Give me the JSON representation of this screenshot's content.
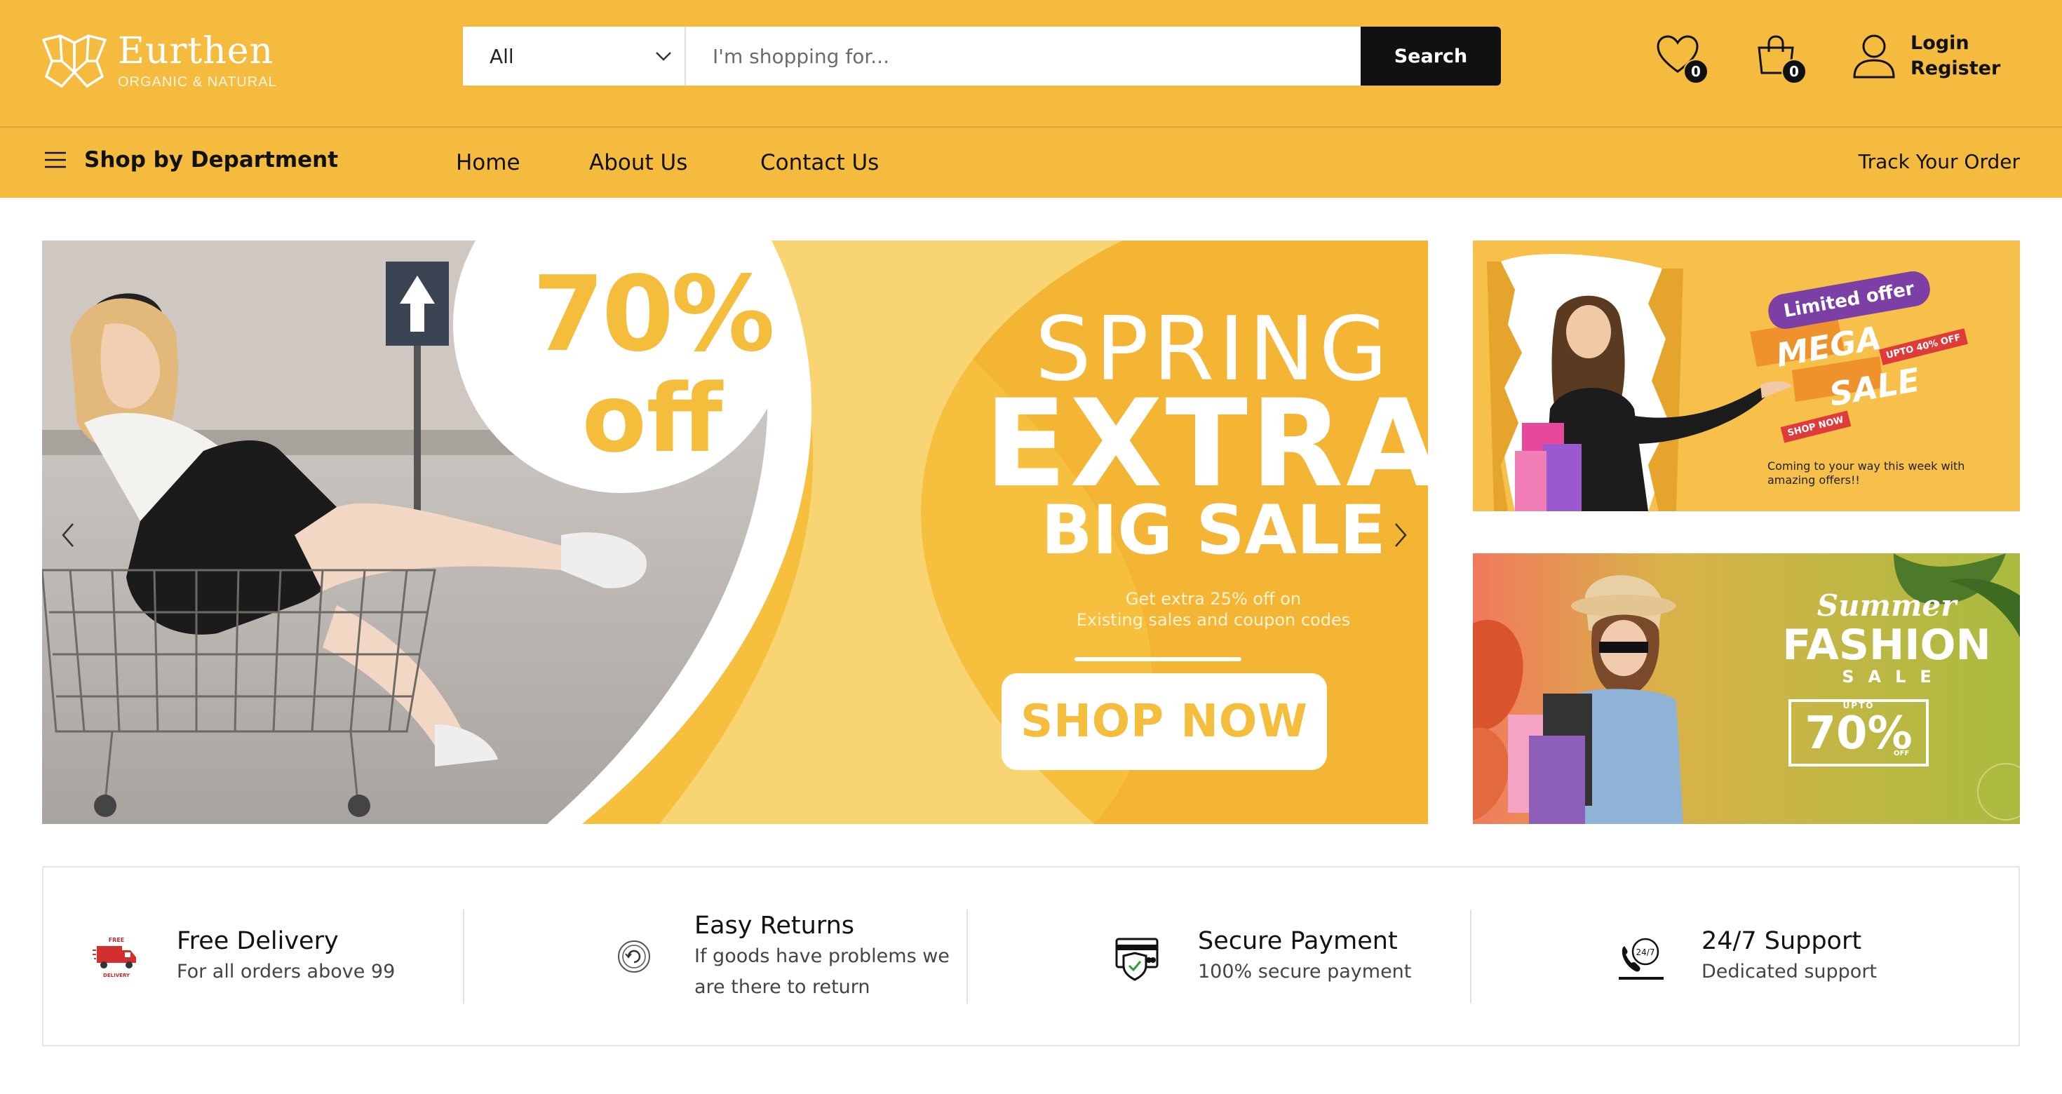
{
  "brand": {
    "name": "Eurthen",
    "tagline": "ORGANIC & NATURAL"
  },
  "search": {
    "category": "All",
    "placeholder": "I'm shopping for...",
    "button_label": "Search"
  },
  "header": {
    "wishlist_count": "0",
    "cart_count": "0",
    "login_label": "Login",
    "register_label": "Register"
  },
  "nav": {
    "department_label": "Shop by Department",
    "links": [
      "Home",
      "About Us",
      "Contact Us"
    ],
    "track_label": "Track Your Order"
  },
  "hero": {
    "discount": "70%",
    "discount_suffix": "off",
    "line1": "SPRING",
    "line2": "EXTRA",
    "line3": "BIG SALE",
    "subtitle_1": "Get extra 25% off on",
    "subtitle_2": "Existing sales and coupon codes",
    "cta": "SHOP NOW"
  },
  "side_banner_1": {
    "badge": "Limited offer",
    "mega": "MEGA",
    "sale": "SALE",
    "upto": "UPTO 40% OFF",
    "shop_now": "SHOP NOW",
    "caption": "Coming to your way this week with amazing offers!!"
  },
  "side_banner_2": {
    "summer": "Summer",
    "fashion": "FASHION",
    "sale": "SALE",
    "upto": "UPTO",
    "percent": "70%",
    "off": "OFF"
  },
  "features": [
    {
      "icon": "free-delivery-icon",
      "title": "Free Delivery",
      "desc": "For all orders above 99",
      "desc2": ""
    },
    {
      "icon": "easy-returns-icon",
      "title": "Easy Returns",
      "desc": "If goods have problems we",
      "desc2": "are there to return"
    },
    {
      "icon": "secure-payment-icon",
      "title": "Secure Payment",
      "desc": "100% secure payment",
      "desc2": ""
    },
    {
      "icon": "support-icon",
      "title": "24/7 Support",
      "desc": "Dedicated support",
      "desc2": ""
    }
  ],
  "colors": {
    "brand_yellow": "#F4BB3F",
    "black": "#111111"
  }
}
